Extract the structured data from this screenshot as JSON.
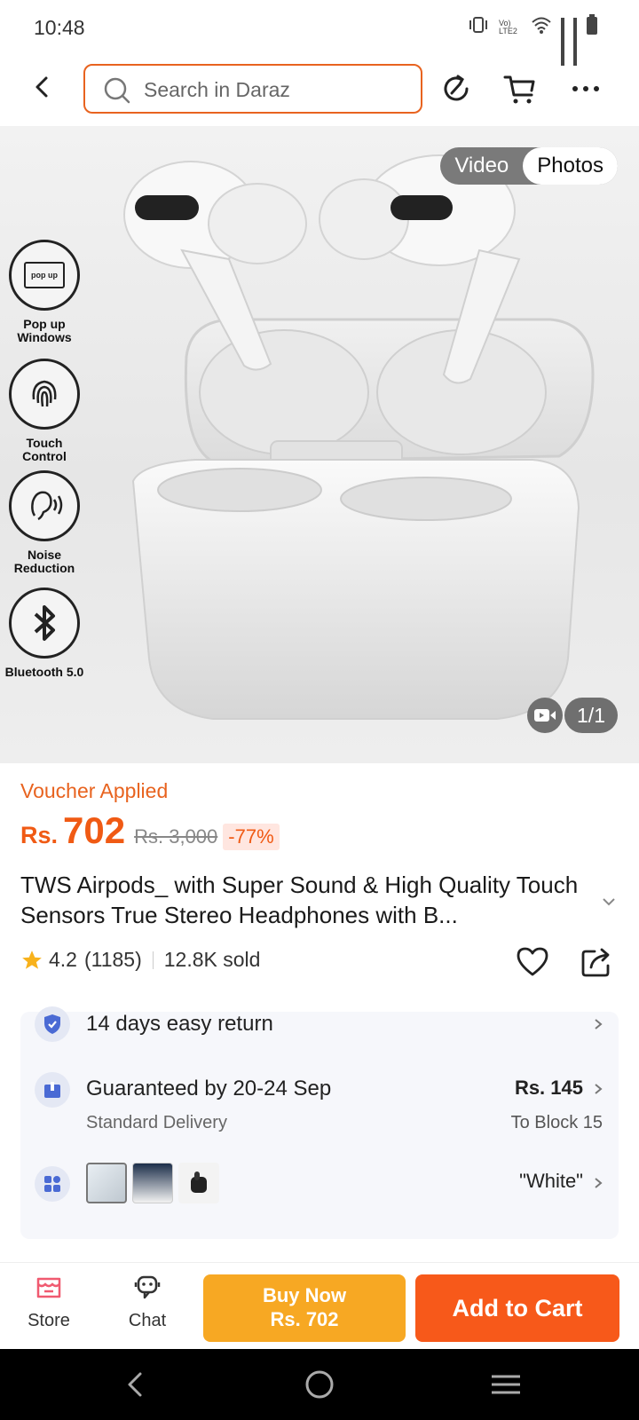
{
  "status_bar": {
    "time": "10:48",
    "network_label": "Vo) LTE2"
  },
  "header": {
    "search_placeholder": "Search in Daraz"
  },
  "gallery": {
    "toggle": {
      "video": "Video",
      "photos": "Photos"
    },
    "counter": "1/1",
    "features": [
      {
        "label": "Pop up Windows",
        "icon_text": "pop up"
      },
      {
        "label": "Touch Control"
      },
      {
        "label": "Noise Reduction"
      },
      {
        "label": "Bluetooth 5.0"
      }
    ]
  },
  "product": {
    "voucher": "Voucher Applied",
    "currency": "Rs.",
    "price": "702",
    "original_price": "Rs. 3,000",
    "discount": "-77%",
    "title": "TWS Airpods_ with Super Sound & High Quality Touch Sensors True Stereo Headphones with B...",
    "rating": "4.2",
    "reviews": "(1185)",
    "sold": "12.8K sold"
  },
  "info": {
    "return": "14 days easy return",
    "delivery_title": "Guaranteed by 20-24 Sep",
    "delivery_sub": "Standard Delivery",
    "delivery_fee": "Rs. 145",
    "delivery_to": "To Block 15",
    "variant": "\"White\""
  },
  "bottom_bar": {
    "store": "Store",
    "chat": "Chat",
    "buy_now": "Buy Now",
    "buy_now_price": "Rs. 702",
    "add_to_cart": "Add to Cart"
  },
  "colors": {
    "accent": "#f05a14",
    "buy": "#f7a823",
    "cart": "#f7591a"
  }
}
